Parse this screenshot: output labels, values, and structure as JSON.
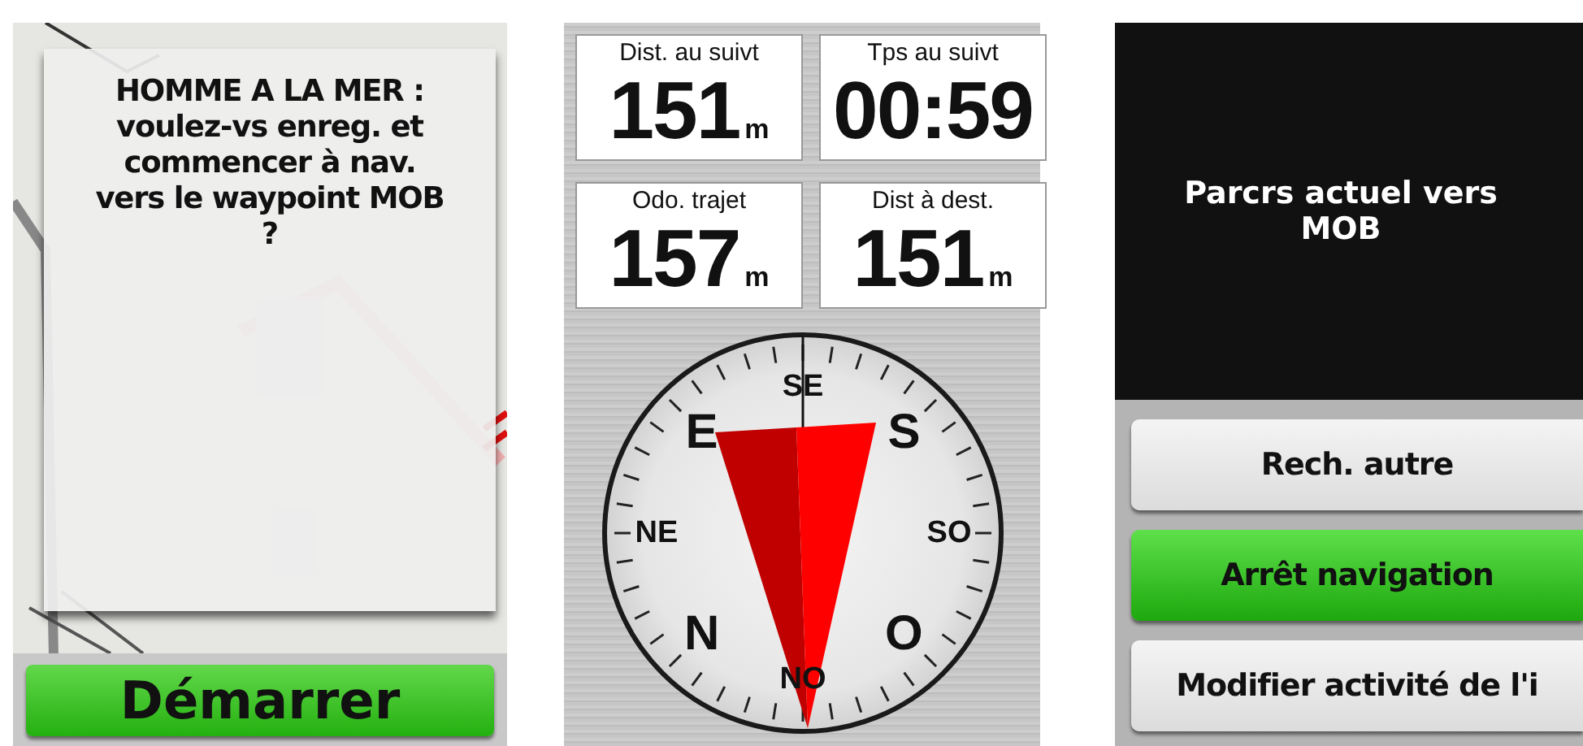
{
  "mob_prompt": {
    "message": "HOMME A LA MER :\nvoulez-vs enreg. et\ncommencer à nav.\nvers le waypoint MOB\n?",
    "button": {
      "label": "Démarrer"
    }
  },
  "trip_computer": {
    "fields": [
      {
        "label": "Dist. au suivt",
        "value": "151",
        "unit": "m"
      },
      {
        "label": "Tps au suivt",
        "value": "00:59"
      },
      {
        "label": "Odo. trajet",
        "value": "157",
        "unit": "m"
      },
      {
        "label": "Dist à dest.",
        "value": "151",
        "unit": "m"
      }
    ],
    "compass": {
      "labels": [
        {
          "text": "SE",
          "kind": "intercardinal"
        },
        {
          "text": "S",
          "kind": "cardinal"
        },
        {
          "text": "SO",
          "kind": "intercardinal"
        },
        {
          "text": "O",
          "kind": "cardinal"
        },
        {
          "text": "NO",
          "kind": "intercardinal"
        },
        {
          "text": "N",
          "kind": "cardinal"
        },
        {
          "text": "NE",
          "kind": "intercardinal"
        },
        {
          "text": "E",
          "kind": "cardinal"
        }
      ]
    }
  },
  "navigation_menu": {
    "message": "Parcrs actuel vers\nMOB",
    "buttons": [
      {
        "label": "Rech. autre",
        "selected": false
      },
      {
        "label": "Arrêt navigation",
        "selected": true
      },
      {
        "label": "Modifier activité de l'i",
        "selected": false
      }
    ]
  }
}
